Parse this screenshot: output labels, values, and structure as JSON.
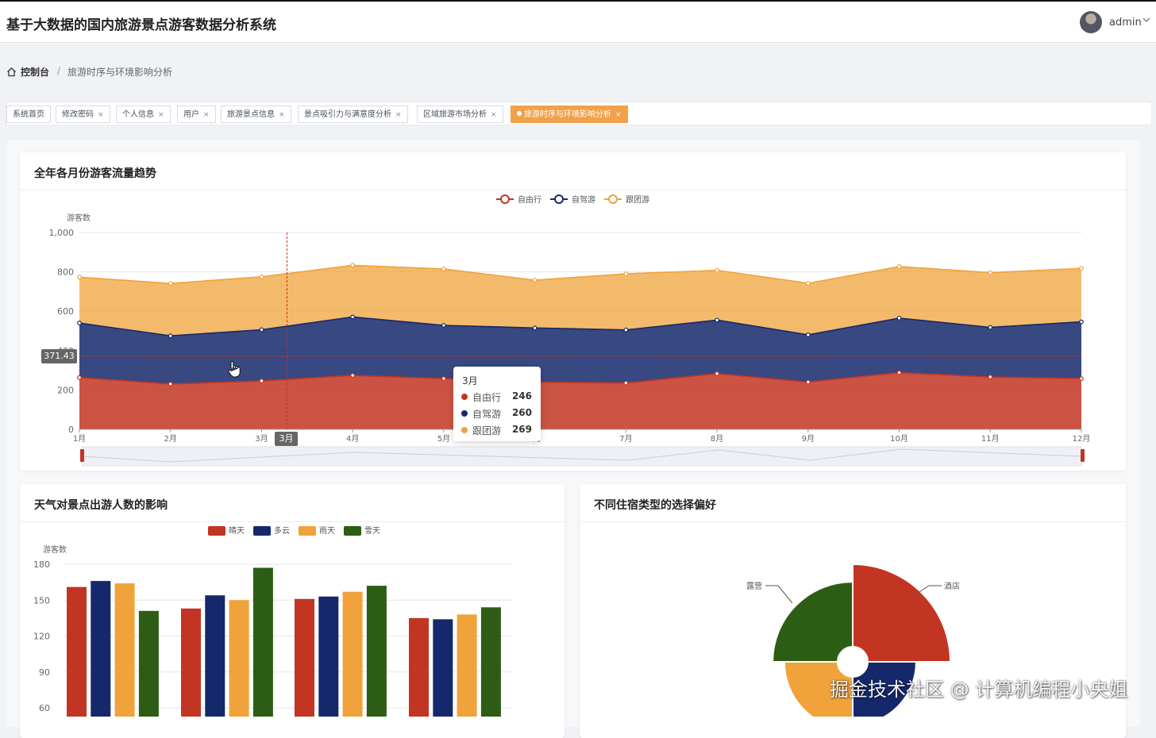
{
  "header": {
    "app_title": "基于大数据的国内旅游景点游客数据分析系统",
    "user_name": "admin"
  },
  "breadcrumb": {
    "root": "控制台",
    "separator": "/",
    "current": "旅游时序与环境影响分析"
  },
  "tabs": [
    {
      "label": "系统首页",
      "closable": false,
      "active": false
    },
    {
      "label": "修改密码",
      "closable": true,
      "active": false
    },
    {
      "label": "个人信息",
      "closable": true,
      "active": false
    },
    {
      "label": "用户",
      "closable": true,
      "active": false
    },
    {
      "label": "旅游景点信息",
      "closable": true,
      "active": false
    },
    {
      "label": "景点吸引力与满意度分析",
      "closable": true,
      "active": false
    },
    {
      "label": "区域旅游市场分析",
      "closable": true,
      "active": false
    },
    {
      "label": "旅游时序与环境影响分析",
      "closable": true,
      "active": true
    }
  ],
  "tab_close_glyph": "×",
  "cards": {
    "monthly": {
      "title": "全年各月份游客流量趋势"
    },
    "weather": {
      "title": "天气对景点出游人数的影响"
    },
    "lodging": {
      "title": "不同住宿类型的选择偏好"
    }
  },
  "tooltip": {
    "title": "3月",
    "rows": [
      {
        "name": "自由行",
        "value": "246",
        "color": "#c23522"
      },
      {
        "name": "自驾游",
        "value": "260",
        "color": "#15286b"
      },
      {
        "name": "跟团游",
        "value": "269",
        "color": "#f0a33a"
      }
    ]
  },
  "axis_pointer": {
    "y_label": "371.43",
    "x_label": "3月"
  },
  "watermark": "掘金技术社区 @ 计算机编程小央姐",
  "colors": {
    "accent": "#f0a14a",
    "free": "#c23522",
    "drive": "#15286b",
    "group": "#f0a33a",
    "snow": "#2d5d14"
  },
  "icons": {
    "home": "home-icon",
    "caret": "chevron-down-icon",
    "pointer": "hand-pointer-icon"
  },
  "chart_data": [
    {
      "type": "area",
      "stacked": true,
      "title": "全年各月份游客流量趋势",
      "ylabel": "游客数",
      "ylim": [
        0,
        1000
      ],
      "yticks": [
        0,
        200,
        400,
        600,
        800,
        1000
      ],
      "ytick_labels": [
        "0",
        "200",
        "400",
        "600",
        "800",
        "1,000"
      ],
      "categories": [
        "1月",
        "2月",
        "3月",
        "4月",
        "5月",
        "6月",
        "7月",
        "8月",
        "9月",
        "10月",
        "11月",
        "12月"
      ],
      "series": [
        {
          "name": "自由行",
          "color": "#c23522",
          "values": [
            263,
            230,
            246,
            274,
            258,
            240,
            235,
            283,
            240,
            288,
            266,
            258
          ]
        },
        {
          "name": "自驾游",
          "color": "#15286b",
          "values": [
            277,
            245,
            260,
            297,
            270,
            275,
            270,
            272,
            240,
            277,
            252,
            288
          ]
        },
        {
          "name": "跟团游",
          "color": "#f0a33a",
          "values": [
            233,
            266,
            269,
            262,
            287,
            243,
            285,
            253,
            262,
            262,
            278,
            272
          ]
        }
      ],
      "legend": "top-center",
      "grid": true
    },
    {
      "type": "bar",
      "title": "天气对景点出游人数的影响",
      "ylabel": "游客数",
      "ylim": [
        60,
        180
      ],
      "yticks": [
        60,
        90,
        120,
        150,
        180
      ],
      "groups_visible": 4,
      "series": [
        {
          "name": "晴天",
          "color": "#c23522",
          "values": [
            161,
            143,
            151,
            135
          ]
        },
        {
          "name": "多云",
          "color": "#15286b",
          "values": [
            166,
            154,
            153,
            134
          ]
        },
        {
          "name": "雨天",
          "color": "#f0a33a",
          "values": [
            164,
            150,
            157,
            138
          ]
        },
        {
          "name": "雪天",
          "color": "#2d5d14",
          "values": [
            141,
            177,
            162,
            144
          ]
        }
      ],
      "legend": "top-center",
      "grid": true
    },
    {
      "type": "pie",
      "title": "不同住宿类型的选择偏好",
      "rose": true,
      "labels_visible": [
        "露营",
        "酒店"
      ],
      "slices": [
        {
          "name": "酒店",
          "value": 1.0,
          "color": "#c23522"
        },
        {
          "name": "",
          "value": 0.65,
          "color": "#15286b"
        },
        {
          "name": "",
          "value": 0.7,
          "color": "#f0a33a"
        },
        {
          "name": "露营",
          "value": 0.82,
          "color": "#2d5d14"
        }
      ]
    }
  ]
}
